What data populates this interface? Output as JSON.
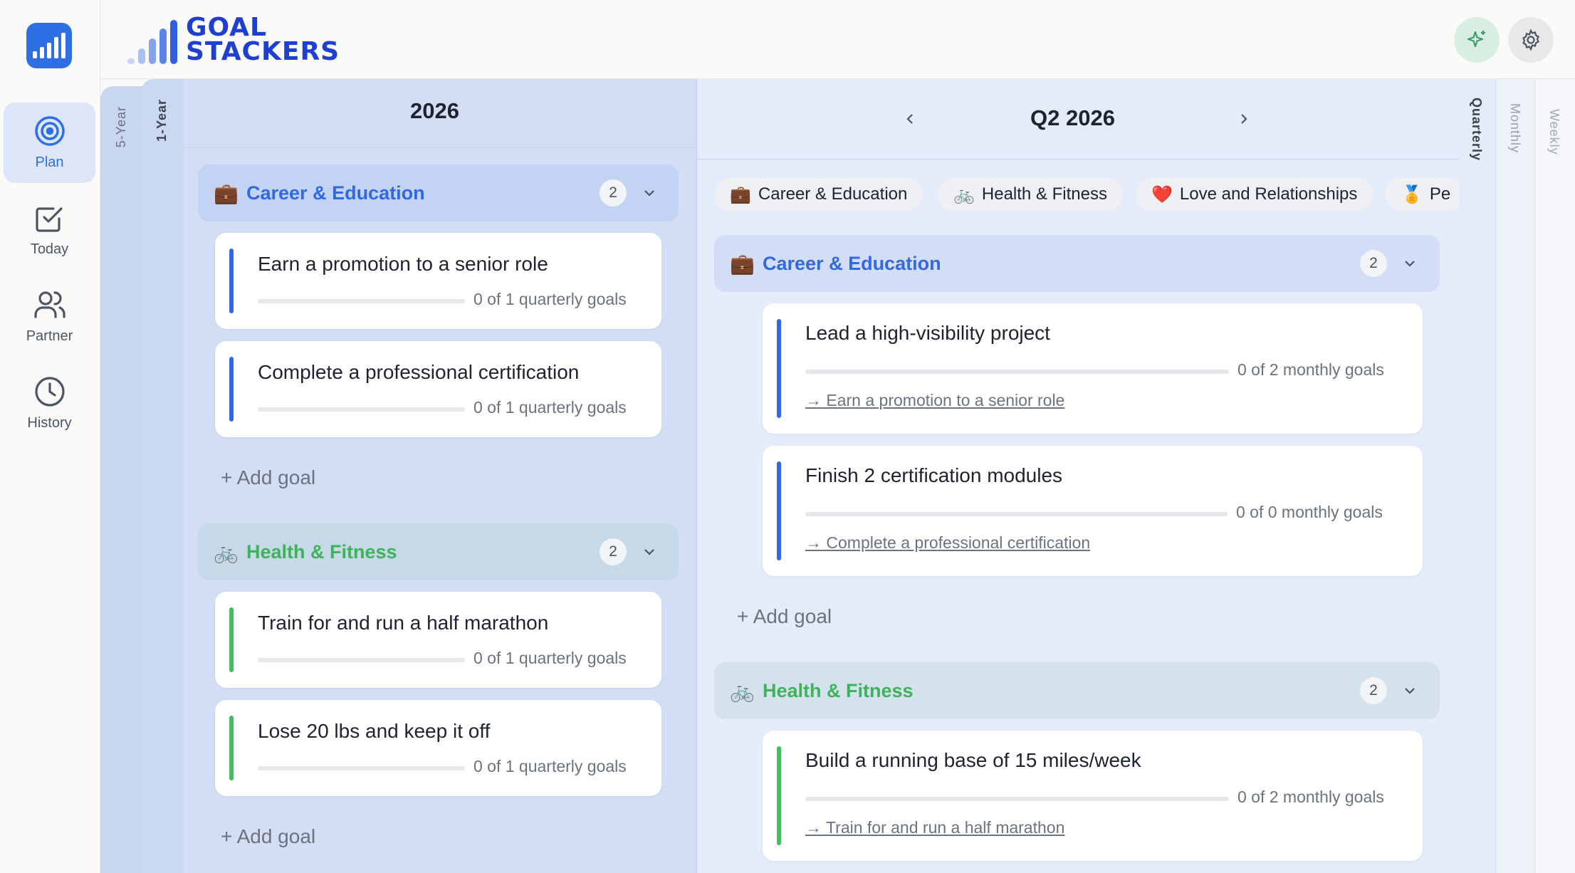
{
  "brand": {
    "line1": "GOAL",
    "line2": "STACKERS"
  },
  "nav": [
    {
      "label": "Plan",
      "icon": "target-icon",
      "active": true
    },
    {
      "label": "Today",
      "icon": "checkbox-icon",
      "active": false
    },
    {
      "label": "Partner",
      "icon": "users-icon",
      "active": false
    },
    {
      "label": "History",
      "icon": "clock-icon",
      "active": false
    }
  ],
  "header": {
    "ai_button_icon": "sparkle-icon",
    "settings_icon": "gear-icon"
  },
  "tabs": {
    "five_year": "5-Year",
    "one_year": "1-Year",
    "quarterly": "Quarterly",
    "monthly": "Monthly",
    "weekly": "Weekly"
  },
  "year_column": {
    "title": "2026",
    "categories": [
      {
        "emoji": "💼",
        "name": "Career & Education",
        "count": "2",
        "goals": [
          {
            "title": "Earn a promotion to a senior role",
            "progress": "0 of 1 quarterly goals",
            "progress_fraction": 0
          },
          {
            "title": "Complete a professional certification",
            "progress": "0 of 1 quarterly goals",
            "progress_fraction": 0
          }
        ],
        "add_label": "+ Add goal"
      },
      {
        "emoji": "🚲",
        "name": "Health & Fitness",
        "count": "2",
        "goals": [
          {
            "title": "Train for and run a half marathon",
            "progress": "0 of 1 quarterly goals",
            "progress_fraction": 0
          },
          {
            "title": "Lose 20 lbs and keep it off",
            "progress": "0 of 1 quarterly goals",
            "progress_fraction": 0
          }
        ],
        "add_label": "+ Add goal"
      }
    ]
  },
  "quarter_column": {
    "title": "Q2 2026",
    "chips": [
      {
        "emoji": "💼",
        "label": "Career & Education"
      },
      {
        "emoji": "🚲",
        "label": "Health & Fitness"
      },
      {
        "emoji": "❤️",
        "label": "Love and Relationships"
      },
      {
        "emoji": "🏅",
        "label": "Pe"
      }
    ],
    "categories": [
      {
        "emoji": "💼",
        "name": "Career & Education",
        "count": "2",
        "goals": [
          {
            "title": "Lead a high-visibility project",
            "progress": "0 of 2 monthly goals",
            "progress_fraction": 0,
            "parent": "→ Earn a promotion to a senior role"
          },
          {
            "title": "Finish 2 certification modules",
            "progress": "0 of 0 monthly goals",
            "progress_fraction": 0,
            "parent": "→ Complete a professional certification"
          }
        ],
        "add_label": "+ Add goal"
      },
      {
        "emoji": "🚲",
        "name": "Health & Fitness",
        "count": "2",
        "goals": [
          {
            "title": "Build a running base of 15 miles/week",
            "progress": "0 of 2 monthly goals",
            "progress_fraction": 0,
            "parent": "→ Train for and run a half marathon"
          }
        ]
      }
    ]
  },
  "colors": {
    "accent": "#2f6fe4",
    "career": "#3468e0",
    "health": "#3fb35a",
    "brand": "#1f3fd1"
  }
}
